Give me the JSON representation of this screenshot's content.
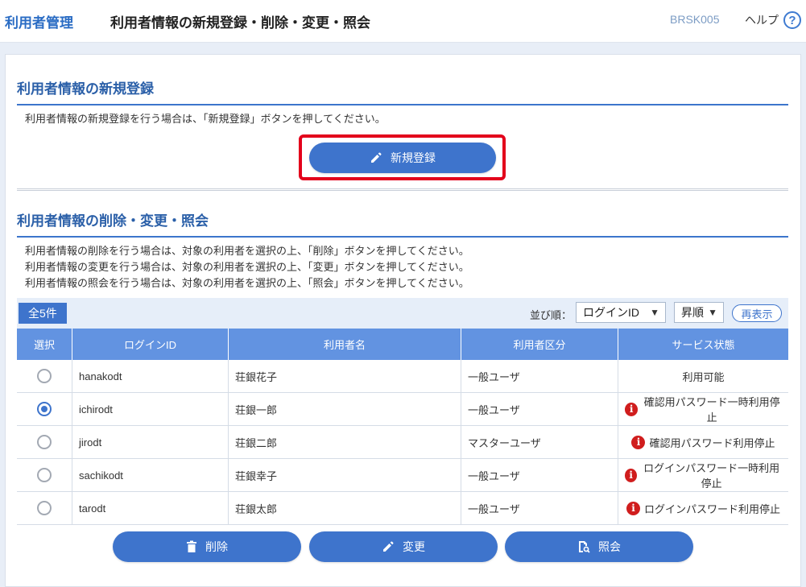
{
  "header": {
    "app_title": "利用者管理",
    "page_title": "利用者情報の新規登録・削除・変更・照会",
    "screen_id": "BRSK005",
    "help_label": "ヘルプ",
    "help_icon_glyph": "?"
  },
  "register_section": {
    "heading": "利用者情報の新規登録",
    "description": "利用者情報の新規登録を行う場合は、「新規登録」ボタンを押してください。",
    "register_button": {
      "label": "新規登録",
      "icon": "pencil-icon"
    }
  },
  "manage_section": {
    "heading": "利用者情報の削除・変更・照会",
    "descriptions": [
      "利用者情報の削除を行う場合は、対象の利用者を選択の上、「削除」ボタンを押してください。",
      "利用者情報の変更を行う場合は、対象の利用者を選択の上、「変更」ボタンを押してください。",
      "利用者情報の照会を行う場合は、対象の利用者を選択の上、「照会」ボタンを押してください。"
    ]
  },
  "list_toolbar": {
    "total_count": "全5件",
    "sort_label": "並び順：",
    "sort_field": "ログインID",
    "sort_order": "昇順",
    "redisplay_label": "再表示"
  },
  "table": {
    "columns": [
      "選択",
      "ログインID",
      "利用者名",
      "利用者区分",
      "サービス状態"
    ],
    "rows": [
      {
        "selected": false,
        "login_id": "hanakodt",
        "name": "荘銀花子",
        "type": "一般ユーザ",
        "status": "利用可能",
        "status_alert": false
      },
      {
        "selected": true,
        "login_id": "ichirodt",
        "name": "荘銀一郎",
        "type": "一般ユーザ",
        "status": "確認用パスワード一時利用停止",
        "status_alert": true
      },
      {
        "selected": false,
        "login_id": "jirodt",
        "name": "荘銀二郎",
        "type": "マスターユーザ",
        "status": "確認用パスワード利用停止",
        "status_alert": true
      },
      {
        "selected": false,
        "login_id": "sachikodt",
        "name": "荘銀幸子",
        "type": "一般ユーザ",
        "status": "ログインパスワード一時利用停止",
        "status_alert": true
      },
      {
        "selected": false,
        "login_id": "tarodt",
        "name": "荘銀太郎",
        "type": "一般ユーザ",
        "status": "ログインパスワード利用停止",
        "status_alert": true
      }
    ]
  },
  "actions": {
    "delete": {
      "label": "削除",
      "icon": "trash-icon"
    },
    "edit": {
      "label": "変更",
      "icon": "pencil-icon"
    },
    "inquiry": {
      "label": "照会",
      "icon": "document-search-icon"
    }
  },
  "colors": {
    "accent": "#3e74cc",
    "table_header": "#6293e1",
    "highlight": "#e3001b",
    "alert": "#d01d1d"
  },
  "alert_icon_glyph": "i"
}
